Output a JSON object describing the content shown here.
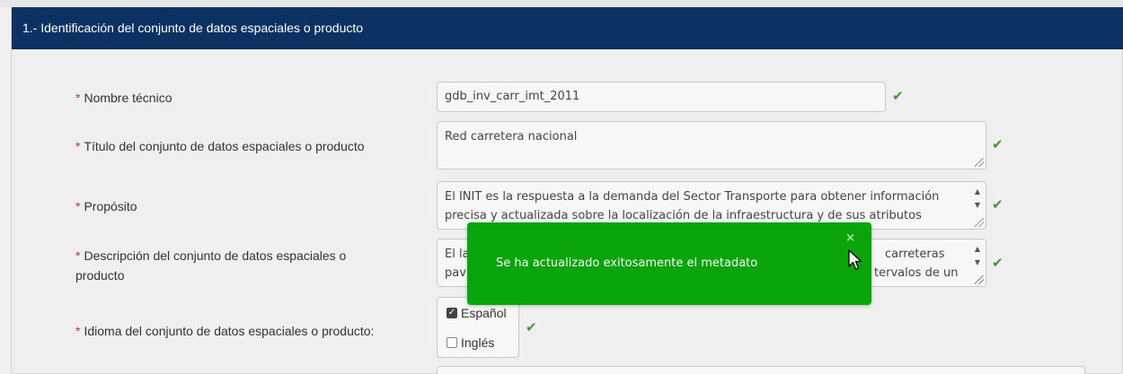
{
  "section": {
    "title": "1.- Identificación del conjunto de datos espaciales o producto"
  },
  "form": {
    "required_marker": "*",
    "check_glyph": "✔",
    "fields": [
      {
        "label": "Nombre técnico",
        "value": "gdb_inv_carr_imt_2011"
      },
      {
        "label": "Título del conjunto de datos espaciales o producto",
        "value": "Red carretera nacional"
      },
      {
        "label": "Propósito",
        "line1": "El INIT es la respuesta a la demanda del Sector Transporte para obtener información",
        "line2": "precisa y actualizada sobre la localización de la infraestructura y de sus atributos"
      },
      {
        "label_line1": "Descripción del conjunto de datos espaciales o",
        "label_line2": "producto",
        "line1_start": "El la",
        "line1_end": "carreteras",
        "line2_start": "pavi",
        "line2_end": "tervalos de un"
      },
      {
        "label": "Idioma del conjunto de datos espaciales o producto:"
      }
    ],
    "languages": [
      {
        "label": "Español",
        "checked": true
      },
      {
        "label": "Inglés",
        "checked": false
      }
    ]
  },
  "toast": {
    "message": "Se ha actualizado exitosamente el metadato",
    "close_glyph": "×",
    "color": "#0aa50a"
  },
  "colors": {
    "header_bg": "#0c3163",
    "required": "#c0392b",
    "check": "#3c9a2c"
  }
}
